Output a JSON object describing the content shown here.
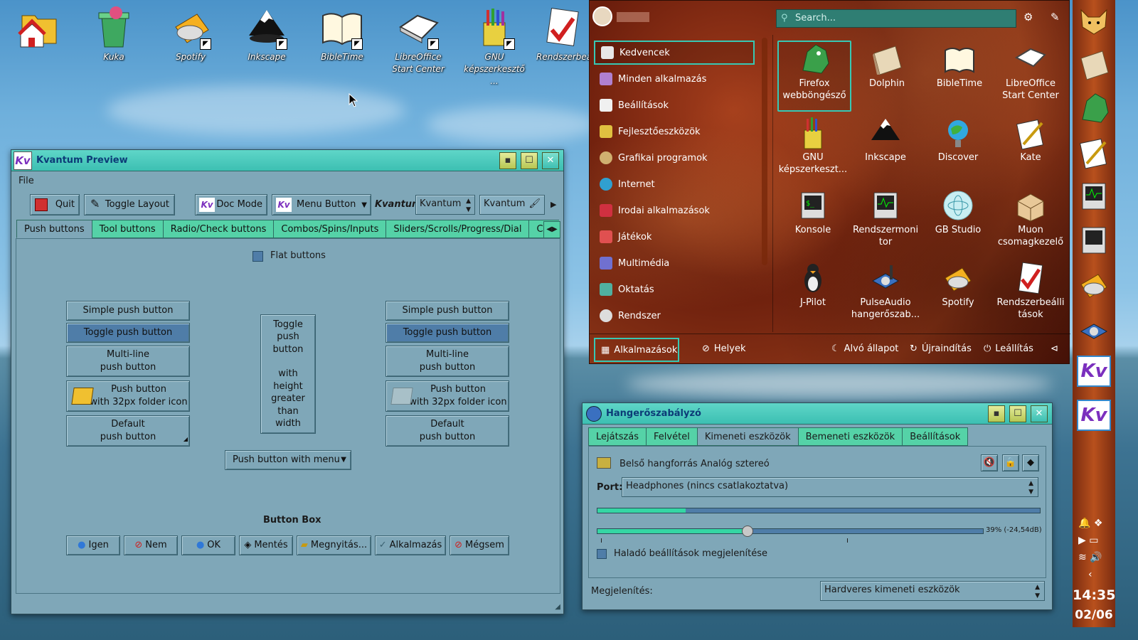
{
  "desktop": {
    "icons": [
      {
        "label": "",
        "name": "home"
      },
      {
        "label": "Kuka",
        "name": "trash"
      },
      {
        "label": "Spotify",
        "name": "spotify"
      },
      {
        "label": "Inkscape",
        "name": "inkscape"
      },
      {
        "label": "BibleTime",
        "name": "bibletime"
      },
      {
        "label": "LibreOffice Start Center",
        "name": "libreoffice"
      },
      {
        "label": "GNU képszerkesztő ...",
        "name": "gimp"
      },
      {
        "label": "Rendszerbeállítások",
        "name": "systemsettings"
      }
    ]
  },
  "kvantum": {
    "title": "Kvantum Preview",
    "menu_file": "File",
    "toolbar": {
      "quit": "Quit",
      "toggle_layout": "Toggle Layout",
      "doc_mode": "Doc Mode",
      "menu_button": "Menu Button",
      "kvantum_label": "Kvantum",
      "combo_value": "Kvantum",
      "edit_value": "Kvantum"
    },
    "tabs": [
      "Push buttons",
      "Tool buttons",
      "Radio/Check buttons",
      "Combos/Spins/Inputs",
      "Sliders/Scrolls/Progress/Dial",
      "Contai"
    ],
    "flat_buttons": "Flat buttons",
    "left_col": {
      "simple": "Simple push button",
      "toggle": "Toggle push button",
      "multiline_1": "Multi-line",
      "multiline_2": "push button",
      "folder_1": "Push button",
      "folder_2": "with 32px folder icon",
      "default_1": "Default",
      "default_2": "push button"
    },
    "toggle_tall": [
      "Toggle",
      "push",
      "button",
      "",
      "with",
      "height",
      "greater",
      "than",
      "width"
    ],
    "push_menu": "Push button with menu",
    "button_box_title": "Button Box",
    "button_box": [
      "Igen",
      "Nem",
      "OK",
      "Mentés",
      "Megnyitás...",
      "Alkalmazás",
      "Mégsem"
    ]
  },
  "launcher": {
    "search_placeholder": "Search...",
    "categories": [
      "Kedvencek",
      "Minden alkalmazás",
      "Beállítások",
      "Fejlesztőeszközök",
      "Grafikai programok",
      "Internet",
      "Irodai alkalmazások",
      "Játékok",
      "Multimédia",
      "Oktatás",
      "Rendszer"
    ],
    "apps": [
      [
        "Firefox",
        "webböngésző"
      ],
      [
        "Dolphin",
        ""
      ],
      [
        "BibleTime",
        ""
      ],
      [
        "LibreOffice",
        "Start Center"
      ],
      [
        "GNU",
        "képszerkeszt..."
      ],
      [
        "Inkscape",
        ""
      ],
      [
        "Discover",
        ""
      ],
      [
        "Kate",
        ""
      ],
      [
        "Konsole",
        ""
      ],
      [
        "Rendszermoni",
        "tor"
      ],
      [
        "GB Studio",
        ""
      ],
      [
        "Muon",
        "csomagkezelő"
      ],
      [
        "J-Pilot",
        ""
      ],
      [
        "PulseAudio",
        "hangerőszab..."
      ],
      [
        "Spotify",
        ""
      ],
      [
        "Rendszerbeálli",
        "tások"
      ]
    ],
    "footer": {
      "applications": "Alkalmazások",
      "places": "Helyek",
      "sleep": "Alvó állapot",
      "restart": "Újraindítás",
      "shutdown": "Leállítás"
    }
  },
  "volume": {
    "title": "Hangerőszabályzó",
    "tabs": [
      "Lejátszás",
      "Felvétel",
      "Kimeneti eszközök",
      "Bemeneti eszközök",
      "Beállítások"
    ],
    "device": "Belső hangforrás Analóg sztereó",
    "port_label": "Port:",
    "port_value": "Headphones (nincs csatlakoztatva)",
    "level_readout": "39% (-24,54dB)",
    "level_fraction": 0.39,
    "meter_fraction": 0.2,
    "advanced": "Haladó beállítások megjelenítése",
    "show_label": "Megjelenítés:",
    "show_value": "Hardveres kimeneti eszközök"
  },
  "clock": {
    "time": "14:35",
    "date": "02/06"
  }
}
